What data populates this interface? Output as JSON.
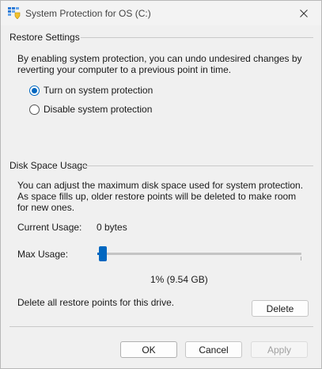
{
  "window": {
    "title": "System Protection for OS (C:)"
  },
  "restore_settings": {
    "heading": "Restore Settings",
    "description": "By enabling system protection, you can undo undesired changes by reverting your computer to a previous point in time.",
    "options": [
      {
        "label": "Turn on system protection",
        "selected": true
      },
      {
        "label": "Disable system protection",
        "selected": false
      }
    ]
  },
  "disk_space": {
    "heading": "Disk Space Usage",
    "description": "You can adjust the maximum disk space used for system protection. As space fills up, older restore points will be deleted to make room for new ones.",
    "current_usage_label": "Current Usage:",
    "current_usage_value": "0 bytes",
    "max_usage_label": "Max Usage:",
    "max_usage_percent": 1,
    "max_usage_text": "1% (9.54 GB)",
    "delete_text": "Delete all restore points for this drive.",
    "delete_label": "Delete"
  },
  "footer": {
    "ok_label": "OK",
    "cancel_label": "Cancel",
    "apply_label": "Apply"
  },
  "colors": {
    "accent": "#0067c0"
  },
  "icons": {
    "app": "system-protection-icon",
    "close": "close-icon"
  }
}
